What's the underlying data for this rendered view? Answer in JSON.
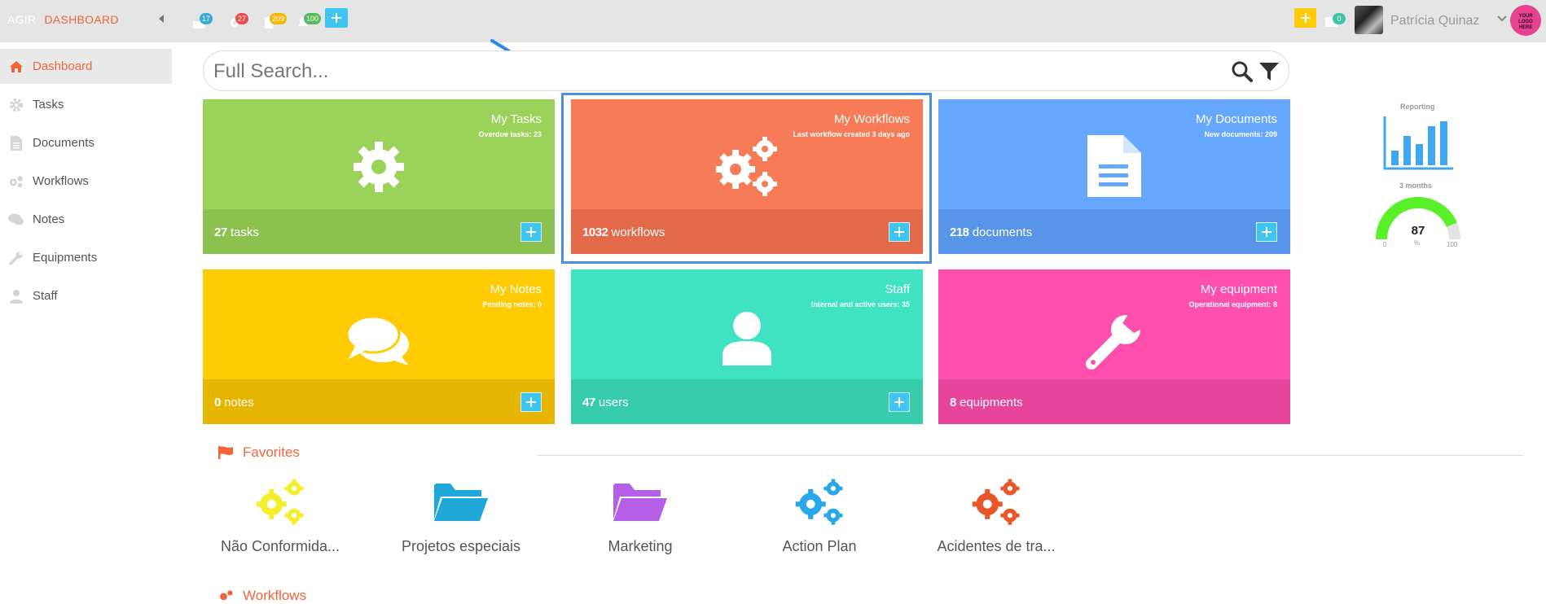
{
  "topbar": {
    "brand": "AGIR",
    "section": "DASHBOARD",
    "badges": [
      {
        "icon": "calendar-icon",
        "count": "17",
        "color": "#3aa9d8"
      },
      {
        "icon": "gear-icon",
        "count": "27",
        "color": "#e84c4c"
      },
      {
        "icon": "document-icon",
        "count": "209",
        "color": "#f2b705"
      },
      {
        "icon": "bell-icon",
        "count": "100",
        "color": "#5cb85c"
      }
    ],
    "messages_count": "0",
    "user_name": "Patrícia Quinaz",
    "logo_text": [
      "YOUR",
      "LOGO",
      "HERE"
    ]
  },
  "sidebar": {
    "items": [
      {
        "label": "Dashboard",
        "icon": "home-icon"
      },
      {
        "label": "Tasks",
        "icon": "gear-icon"
      },
      {
        "label": "Documents",
        "icon": "document-icon"
      },
      {
        "label": "Workflows",
        "icon": "gears-icon"
      },
      {
        "label": "Notes",
        "icon": "comments-icon"
      },
      {
        "label": "Equipments",
        "icon": "wrench-icon"
      },
      {
        "label": "Staff",
        "icon": "user-icon"
      }
    ]
  },
  "search": {
    "placeholder": "Full Search..."
  },
  "cards": [
    {
      "title": "My Tasks",
      "subtitle": "Overdue tasks: 23",
      "count": "27",
      "unit": "tasks",
      "color": "#9bd35a",
      "foot_color": "#8cc04f"
    },
    {
      "title": "My Workflows",
      "subtitle": "Last workflow created 3 days ago",
      "count": "1032",
      "unit": "workflows",
      "color": "#f77b56",
      "foot_color": "#e2694a"
    },
    {
      "title": "My Documents",
      "subtitle": "New documents: 209",
      "count": "218",
      "unit": "documents",
      "color": "#66a7ff",
      "foot_color": "#5894e8"
    },
    {
      "title": "My Notes",
      "subtitle": "Pending notes: 0",
      "count": "0",
      "unit": "notes",
      "color": "#ffcb05",
      "foot_color": "#e6b602"
    },
    {
      "title": "Staff",
      "subtitle": "Internal and active users: 35",
      "count": "47",
      "unit": "users",
      "color": "#3fe3c1",
      "foot_color": "#37ccad"
    },
    {
      "title": "My equipment",
      "subtitle": "Operational equipment: 8",
      "count": "8",
      "unit": "equipments",
      "color": "#ff4fae",
      "foot_color": "#e8449c"
    }
  ],
  "reporting": {
    "label": "Reporting",
    "period": "3 months",
    "gauge_value": "87",
    "gauge_unit": "%",
    "gauge_min": "0",
    "gauge_max": "100"
  },
  "favorites": {
    "title": "Favorites",
    "items": [
      {
        "label": "Não Conformida...",
        "icon": "gears-icon",
        "color": "#f3ef2c"
      },
      {
        "label": "Projetos especiais",
        "icon": "folder-open-icon",
        "color": "#1fa8d8"
      },
      {
        "label": "Marketing",
        "icon": "folder-open-icon",
        "color": "#b55fe8"
      },
      {
        "label": "Action Plan",
        "icon": "gears-icon",
        "color": "#29a7e8"
      },
      {
        "label": "Acidentes de tra...",
        "icon": "gears-icon",
        "color": "#e8562a"
      }
    ]
  },
  "workflows_section": {
    "title": "Workflows"
  }
}
